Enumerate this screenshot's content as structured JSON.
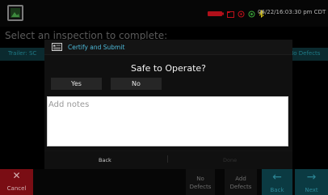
{
  "statusbar": {
    "datetime": "06/22/16:03:30 pm CDT",
    "icons": [
      "battery-icon",
      "folder-icon",
      "gps-icon",
      "signal-icon",
      "bluetooth-icon"
    ]
  },
  "background": {
    "page_title": "Select an inspection to complete:",
    "col_trailer": "Trailer: SC",
    "col_status": "No Defects"
  },
  "modal": {
    "title": "Certify and Submit",
    "question": "Safe to Operate?",
    "yes_label": "Yes",
    "no_label": "No",
    "notes_placeholder": "Add notes",
    "back_label": "Back",
    "done_label": "Done"
  },
  "bottombar": {
    "cancel_label": "Cancel",
    "no_defects_line1": "No",
    "no_defects_line2": "Defects",
    "add_defects_line1": "Add",
    "add_defects_line2": "Defects",
    "back_label": "Back",
    "next_label": "Next"
  },
  "colors": {
    "accent": "#4db9d8",
    "cancel_red": "#7a0d14",
    "nav_teal": "#0b3a42"
  }
}
